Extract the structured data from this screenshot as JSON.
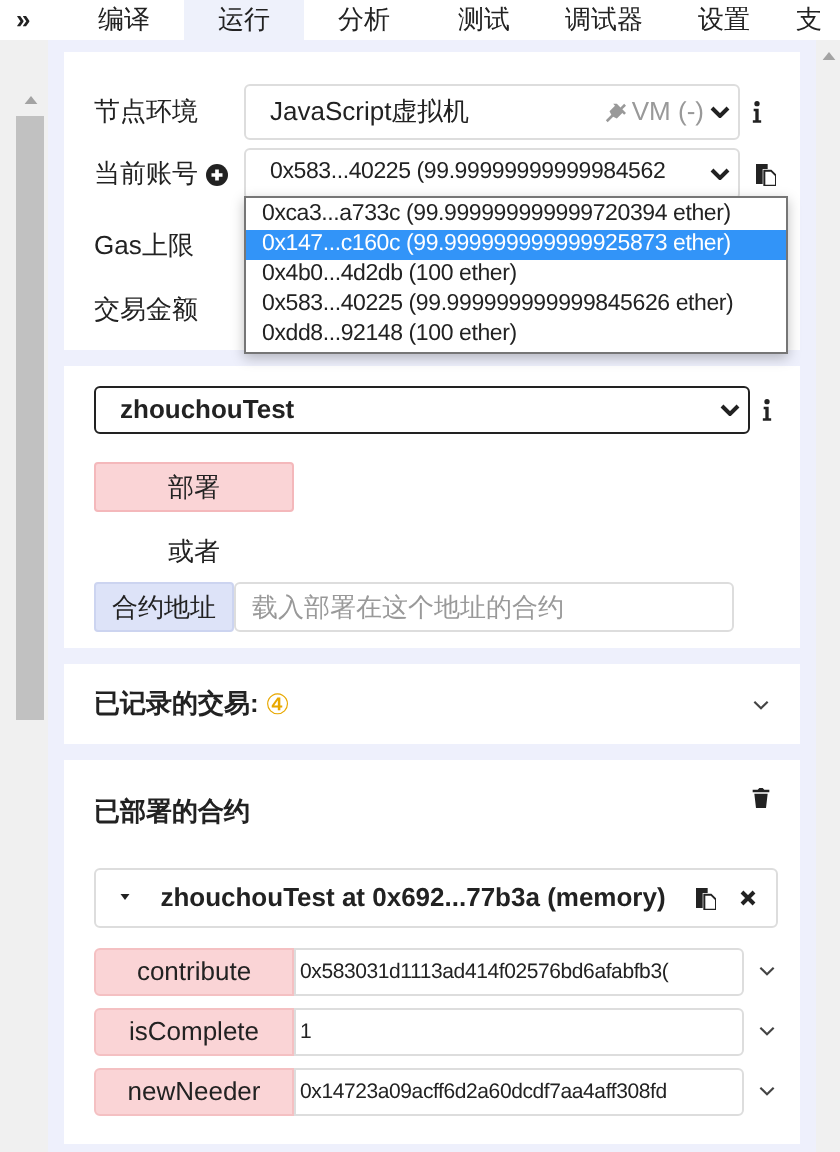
{
  "tabs": [
    {
      "label": "编译",
      "selected": false
    },
    {
      "label": "运行",
      "selected": true
    },
    {
      "label": "分析",
      "selected": false
    },
    {
      "label": "测试",
      "selected": false
    },
    {
      "label": "调试器",
      "selected": false
    },
    {
      "label": "设置",
      "selected": false
    },
    {
      "label": "支",
      "selected": false
    }
  ],
  "collapse_icon_text": "»",
  "environment": {
    "label": "节点环境",
    "value": "JavaScript虚拟机",
    "provider": "VM (-)"
  },
  "account": {
    "label": "当前账号",
    "value": "0x583...40225 (99.99999999999984562"
  },
  "account_options": [
    {
      "text": "0xca3...a733c (99.999999999999720394 ether)",
      "selected": false
    },
    {
      "text": "0x147...c160c (99.999999999999925873 ether)",
      "selected": true
    },
    {
      "text": "0x4b0...4d2db (100 ether)",
      "selected": false
    },
    {
      "text": "0x583...40225 (99.999999999999845626 ether)",
      "selected": false
    },
    {
      "text": "0xdd8...92148 (100 ether)",
      "selected": false
    }
  ],
  "gas_limit": {
    "label": "Gas上限"
  },
  "value_field": {
    "label": "交易金额"
  },
  "contract_select": {
    "value": "zhouchouTest"
  },
  "deploy_button": "部署",
  "or_text": "或者",
  "at_address": {
    "button": "合约地址",
    "placeholder": "载入部署在这个地址的合约"
  },
  "transactions": {
    "title": "已记录的交易:",
    "count": "④"
  },
  "deployed": {
    "title": "已部署的合约",
    "instance": {
      "title": "zhouchouTest at 0x692...77b3a (memory)",
      "expanded": true
    },
    "functions": [
      {
        "name": "contribute",
        "value": "0x583031d1113ad414f02576bd6afabfb3("
      },
      {
        "name": "isComplete",
        "value": "1"
      },
      {
        "name": "newNeeder",
        "value": "0x14723a09acff6d2a60dcdf7aa4aff308fd"
      }
    ]
  }
}
